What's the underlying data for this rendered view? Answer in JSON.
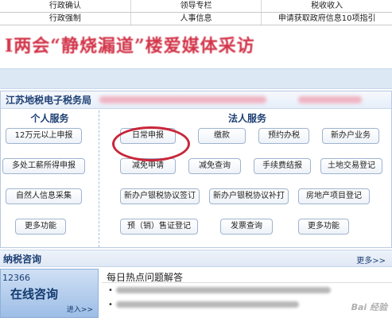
{
  "top_links": {
    "row1": [
      "行政确认",
      "领导专栏",
      "税收收入"
    ],
    "row2": [
      "行政强制",
      "人事信息",
      "申请获取政府信息10项指引"
    ]
  },
  "banner": {
    "headline": "I两会“静烧漏道”楼爱媒体采访"
  },
  "panel": {
    "title": "江苏地税电子税务局",
    "personal_title": "个人服务",
    "corporate_title": "法人服务",
    "personal_buttons": [
      "12万元以上申报",
      "多处工薪所得申报",
      "自然人信息采集",
      "更多功能"
    ],
    "corporate_buttons": [
      [
        "日常申报",
        "缴款",
        "预约办税",
        "新办户业务"
      ],
      [
        "减免申请",
        "减免查询",
        "手续费结报",
        "土地交易登记"
      ],
      [
        "新办户银税协议签订",
        "新办户银税协议补打",
        "房地产项目登记"
      ],
      [
        "预（销）售证登记",
        "发票查询",
        "更多功能"
      ]
    ]
  },
  "consult": {
    "title": "纳税咨询",
    "more": "更多>>",
    "hotline_number": "12366",
    "hotline_main": "在线咨询",
    "hotline_enter": "进入>>",
    "hot_title": "每日热点问题解答"
  },
  "watermark": "Bai 经验"
}
